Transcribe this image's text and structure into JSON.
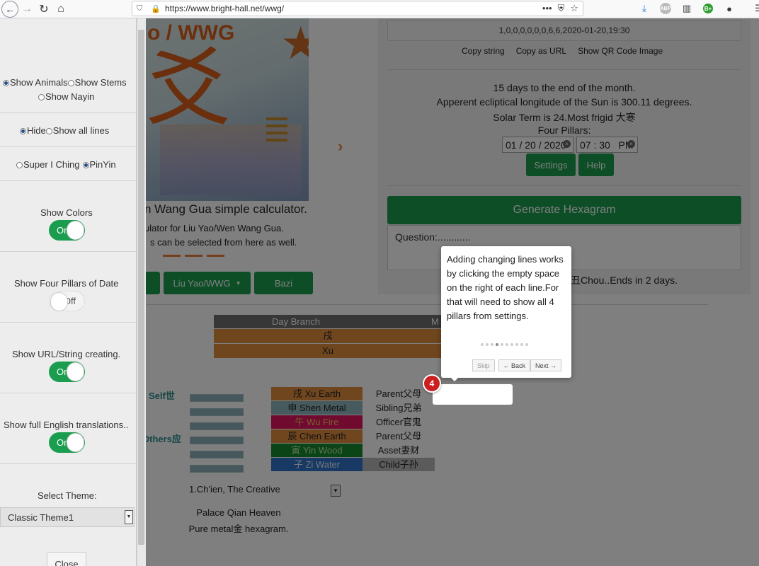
{
  "browser": {
    "url": "https://www.bright-hall.net/wwg/",
    "abp_label": "ABP",
    "gplus_label": "B+",
    "icons": [
      "back-icon",
      "forward-icon",
      "reload-icon",
      "home-icon",
      "shield-icon",
      "lock-icon",
      "more-icon",
      "pocket-icon",
      "star-icon",
      "download-icon",
      "library-icon",
      "account-icon",
      "menu-icon"
    ]
  },
  "hero": {
    "title": "o / WWG",
    "yao_glyph": "爻",
    "caption_main": "n Wang Gua simple calculator.",
    "caption_sub1": "ulator for Liu Yao/Wen Wang Gua.",
    "caption_sub2": "s can be selected from here as well."
  },
  "nav_buttons": {
    "liu_yao": "Liu Yao/WWG",
    "bazi": "Bazi"
  },
  "right": {
    "string_value": "1,0,0,0,0,0,0,6,6,2020-01-20,19:30",
    "links": [
      "Copy string",
      "Copy as URL",
      "Show QR Code Image"
    ],
    "info_lines": [
      "15 days to the end of the month.",
      "Apperent ecliptical longitude of the Sun is 300.11 degrees.",
      "Solar Term is 24.Most frigid 大寒",
      "Four Pillars:"
    ],
    "date_value": "01 / 20 / 2020",
    "time_value": "07 : 30   PM",
    "settings_label": "Settings",
    "help_label": "Help",
    "generate_label": "Generate Hexagram",
    "question_placeholder": "Question:............",
    "moon_text": "丑Chou..Ends in 2 days."
  },
  "table": {
    "headers": [
      "Day Branch",
      "M"
    ],
    "rows": [
      "戌",
      "Xu"
    ]
  },
  "hexagram": {
    "self_label": "Self世",
    "others_label": "Others应",
    "lines": [
      {
        "branch": "戌 Xu Earth",
        "relation": "Parent父母",
        "color": "#e08c3d",
        "text_color": "#222222",
        "rel_bg": "#ffffff"
      },
      {
        "branch": "申 Shen Metal",
        "relation": "Sibling兄弟",
        "color": "#8fb6bd",
        "text_color": "#222222",
        "rel_bg": "#ffffff"
      },
      {
        "branch": "午 Wu Fire",
        "relation": "Officer官鬼",
        "color": "#e0155c",
        "text_color": "#f4c060",
        "rel_bg": "#ffffff"
      },
      {
        "branch": "辰 Chen Earth",
        "relation": "Parent父母",
        "color": "#e08c3d",
        "text_color": "#222222",
        "rel_bg": "#ffffff"
      },
      {
        "branch": "寅 Yin Wood",
        "relation": "Asset妻财",
        "color": "#178a2f",
        "text_color": "#bfe7a8",
        "rel_bg": "#ffffff"
      },
      {
        "branch": "子 Zi Water",
        "relation": "Child子孙",
        "color": "#2f72c8",
        "text_color": "#e6f0ff",
        "rel_bg": "#b7b7b7"
      }
    ],
    "selected_hexagram": "1.Ch'ien, The Creative",
    "palace_line1": "Palace Qian Heaven",
    "palace_line2": "Pure metal金 hexagram."
  },
  "tour": {
    "text": "Adding changing lines works by clicking the empty space on the right of each line.For that will need to show all 4 pillars from settings.",
    "skip": "Skip",
    "back": "← Back",
    "next": "Next →",
    "step": "4",
    "dot_count": 10,
    "active_dot": 3
  },
  "sidebar": {
    "radio_animals": "Show Animals",
    "radio_stems": "Show Stems",
    "radio_nayin": "Show Nayin",
    "radio_hide": "Hide",
    "radio_show_all": "Show all lines",
    "radio_super": "Super I Ching",
    "radio_pinyin": "PinYin",
    "show_colors": "Show Colors",
    "show_colors_state": "On",
    "show_four_pillars": "Show Four Pillars of Date",
    "show_four_pillars_state": "Off",
    "show_url": "Show URL/String creating.",
    "show_url_state": "On",
    "show_full_english": "Show full English translations..",
    "show_full_english_state": "On",
    "select_theme": "Select Theme:",
    "theme_value": "Classic Theme1",
    "close_label": "Close"
  }
}
